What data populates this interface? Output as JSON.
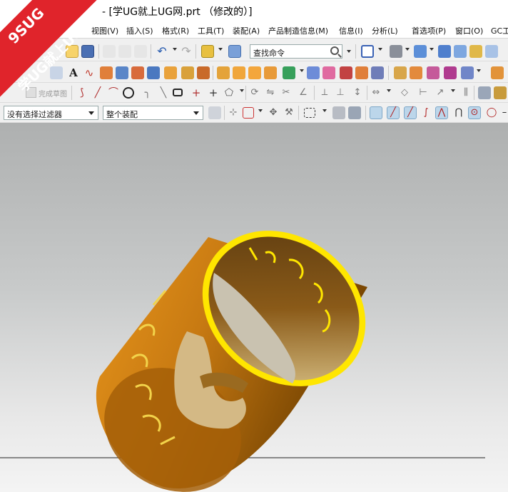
{
  "window": {
    "title": "- [学UG就上UG网.prt （修改的）]"
  },
  "menu": {
    "items": [
      "视图(V)",
      "插入(S)",
      "格式(R)",
      "工具(T)",
      "装配(A)",
      "产品制造信息(M)",
      "信息(I)",
      "分析(L)",
      "首选项(P)",
      "窗口(O)",
      "GC工"
    ]
  },
  "toolbar": {
    "command_search_placeholder": "查找命令",
    "finish_sketch_label": "完成草图",
    "selection_filter": "没有选择过滤器",
    "selection_scope": "整个装配"
  },
  "watermark": {
    "line1": "9SUG",
    "line2": "学UG就上UG网"
  },
  "colors": {
    "accent_red": "#e0242b",
    "model_orange": "#c87a12",
    "model_edge_yellow": "#ffe600",
    "viewport_top": "#aeb0b0",
    "viewport_bottom": "#f4f4f4"
  },
  "icons": {
    "row1": [
      "new-icon",
      "open-icon",
      "save-icon",
      "cut-icon",
      "copy-icon",
      "paste-icon",
      "undo-icon",
      "redo-icon",
      "command-finder-icon",
      "touch-mode-icon",
      "search-icon",
      "view-menu-icon",
      "shaded-cube-icon",
      "orient-view-icon",
      "wireframe-cube-icon",
      "render-style-icon",
      "layer-icon"
    ],
    "row2": [
      "sketch-icon",
      "datum-plane-icon",
      "text-icon",
      "spline-icon",
      "point-icon",
      "extrude-icon",
      "revolve-icon",
      "hole-icon",
      "boss-icon",
      "pocket-icon",
      "rib-icon",
      "emboss-icon",
      "trim-body-icon",
      "pattern-icon",
      "unite-icon",
      "chamfer-icon",
      "blend-icon",
      "shell-icon",
      "draft-icon",
      "thicken-icon",
      "offset-face-icon",
      "split-body-icon",
      "measure-icon"
    ],
    "row3": [
      "finish-sketch-icon",
      "profile-icon",
      "line-icon",
      "arc-icon",
      "circle-icon",
      "fillet-icon",
      "chamfer-2d-icon",
      "rectangle-icon",
      "point-2d-icon",
      "polygon-icon",
      "offset-curve-icon",
      "mirror-curve-icon",
      "quick-trim-icon",
      "quick-extend-icon",
      "make-corner-icon",
      "constraint-icon",
      "dimension-icon",
      "auto-dim-icon",
      "show-constraints-icon",
      "relations-icon"
    ],
    "row4": [
      "filter-icon",
      "snap-point-icon",
      "snap-end-icon",
      "snap-mid-icon",
      "snap-control-icon",
      "box-select-icon",
      "face-icon",
      "body-icon",
      "snap-enable-icon",
      "snap-line-icon",
      "snap-tangent-icon",
      "snap-curve-icon",
      "snap-point-on-curve-icon",
      "snap-intersection-icon",
      "snap-arc-center-icon",
      "snap-quadrant-icon"
    ]
  }
}
